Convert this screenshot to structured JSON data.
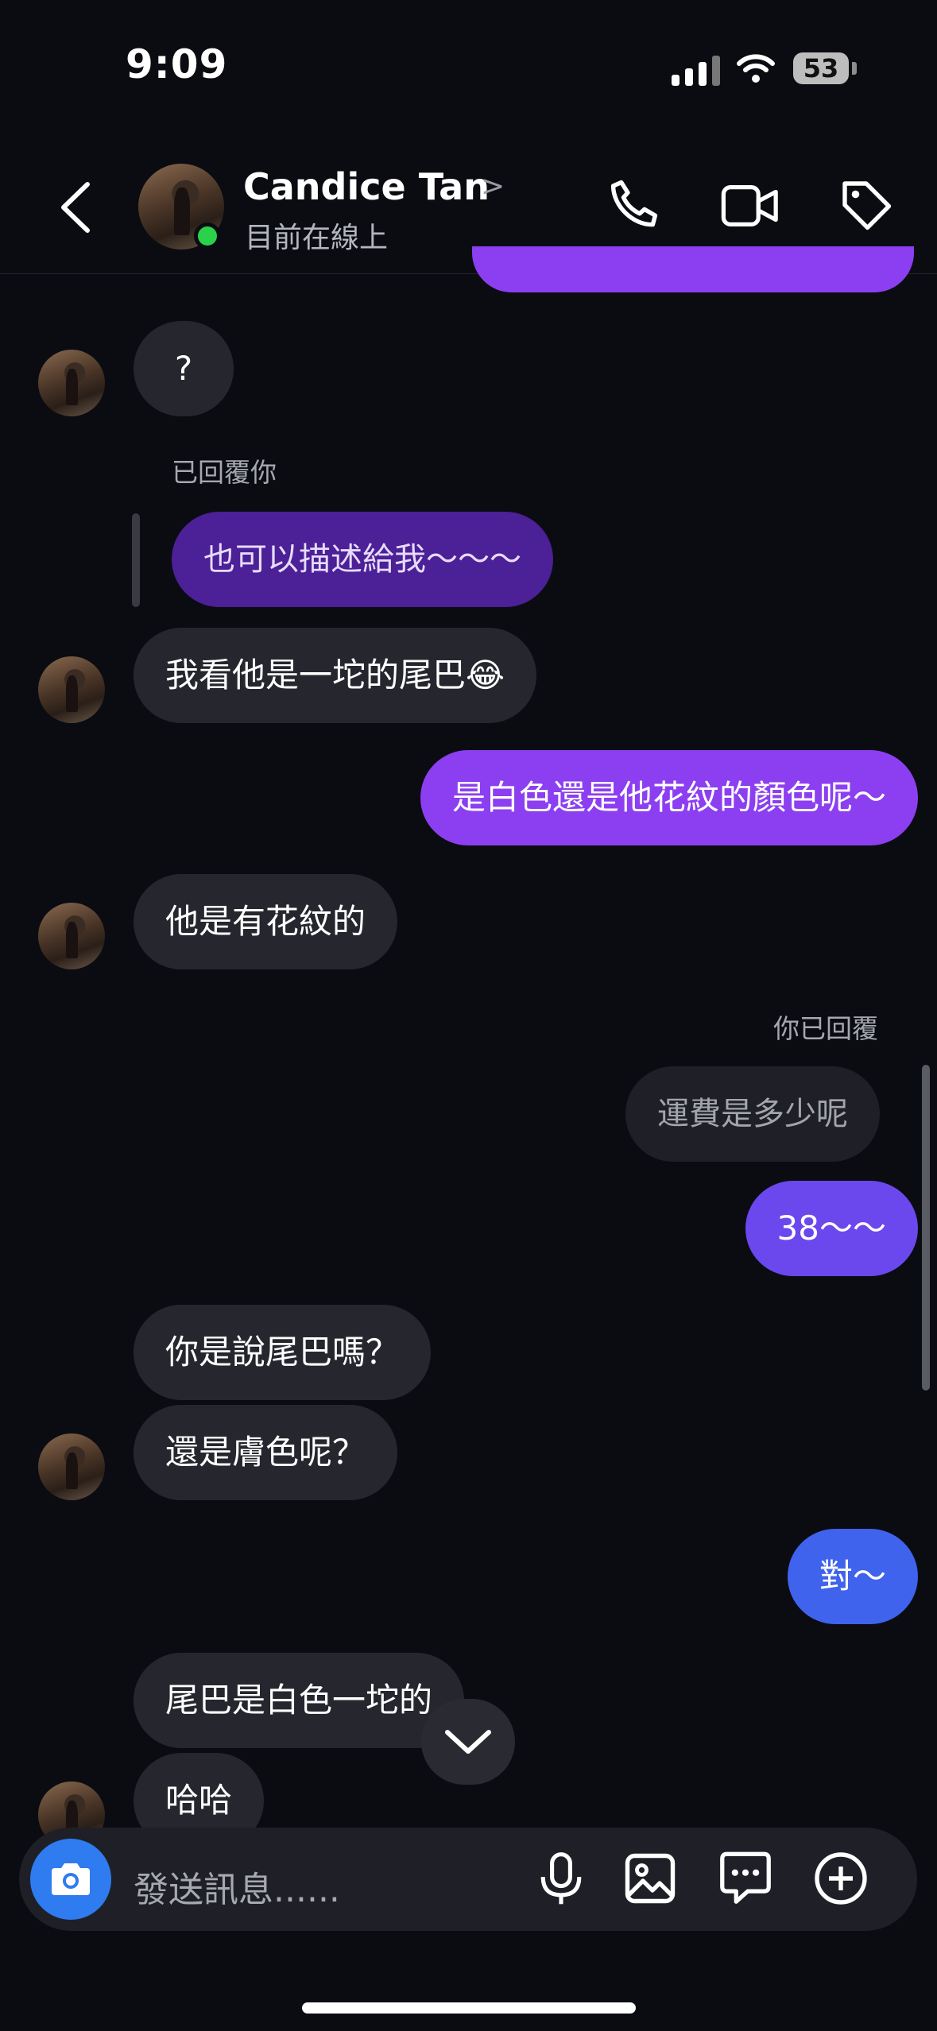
{
  "status_bar": {
    "time": "9:09",
    "battery": "53"
  },
  "header": {
    "contact_name": "Candice Tan",
    "presence": "目前在線上",
    "chevron": ">"
  },
  "messages": {
    "m1": "?",
    "reply_label_incoming": "已回覆你",
    "quoted_1": "也可以描述給我～～～",
    "m2": "我看他是一坨的尾巴😂",
    "m3": "是白色還是他花紋的顏色呢～",
    "m4": "他是有花紋的",
    "reply_label_outgoing": "你已回覆",
    "quoted_2": "運費是多少呢",
    "m5": "38～～",
    "m6": "你是說尾巴嗎？",
    "m7": "還是膚色呢？",
    "m8": "對～",
    "m9": "尾巴是白色一坨的",
    "m10": "哈哈"
  },
  "composer": {
    "placeholder": "發送訊息......"
  },
  "colors": {
    "sent_purple": "#8c3ff0",
    "sent_indigo": "#6a48ee",
    "sent_blue": "#3f63ec",
    "online": "#2ad14b",
    "camera": "#2f7bf0"
  },
  "icons": [
    "back-arrow-icon",
    "phone-icon",
    "video-icon",
    "tag-icon",
    "camera-icon",
    "microphone-icon",
    "gallery-icon",
    "chat-sticker-icon",
    "plus-icon",
    "chevron-down-icon"
  ]
}
